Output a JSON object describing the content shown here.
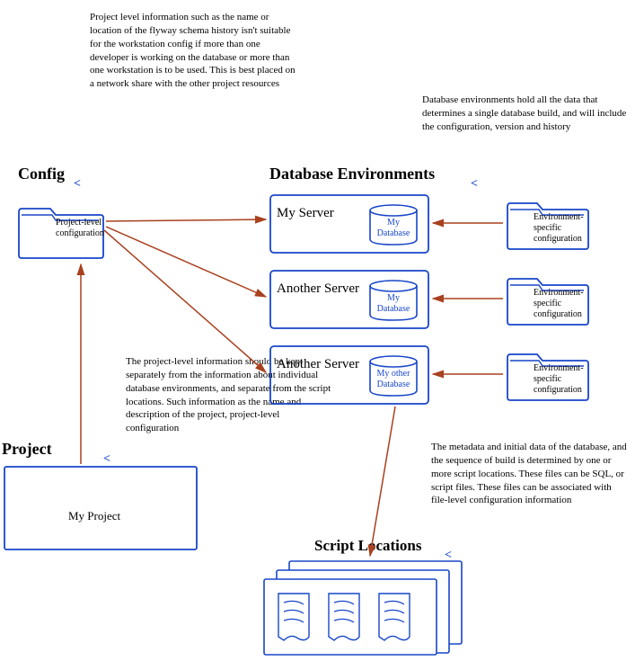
{
  "headings": {
    "config": "Config",
    "db_env": "Database Environments",
    "project": "Project",
    "scripts": "Script Locations"
  },
  "annotations": {
    "config_note": "Project level information such as the name or location of the flyway schema history isn't suitable for the workstation config if more than one developer is working on the database or more than one workstation is to be used. This is best placed on a network share with the other project resources",
    "dbenv_note": "Database environments hold all the data that determines a single database build, and will include the configuration, version and history",
    "project_note": "The project-level information should be kept separately from the information about individual database environments, and separate from the script locations. Such information as the name and description of the project, project-level configuration",
    "scripts_note": "The metadata and initial data of the database, and the sequence of build is determined by one or more script locations. These files can be SQL, or script files. These files can be associated with file-level configuration information"
  },
  "config_folder": {
    "label": "Project-level configuration"
  },
  "environments": [
    {
      "server": "My Server",
      "db": "My Database",
      "folder": "Environment-specific configuration"
    },
    {
      "server": "Another Server",
      "db": "My Database",
      "folder": "Environment-specific configuration"
    },
    {
      "server": "Another Server",
      "db": "My other Database",
      "folder": "Environment-specific configuration"
    }
  ],
  "project": {
    "name": "My Project"
  },
  "colors": {
    "outline": "#1846c9",
    "arrow": "#a8411e"
  }
}
